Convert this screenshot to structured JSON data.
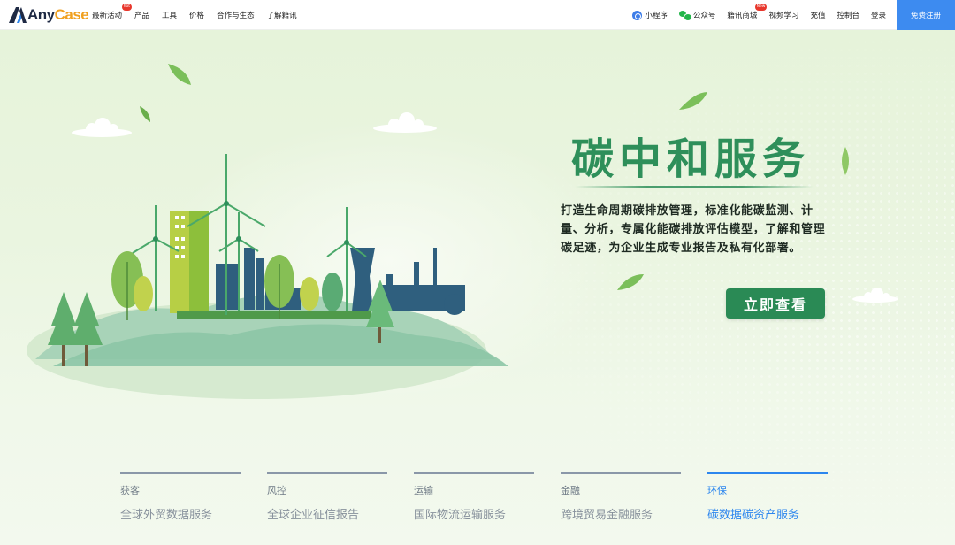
{
  "header": {
    "logo": {
      "part1": "Any",
      "part2": "Case"
    },
    "nav_left": [
      {
        "label": "最新活动",
        "badge": "hot"
      },
      {
        "label": "产品",
        "badge": ""
      },
      {
        "label": "工具",
        "badge": ""
      },
      {
        "label": "价格",
        "badge": ""
      },
      {
        "label": "合作与生态",
        "badge": ""
      },
      {
        "label": "了解籍讯",
        "badge": ""
      }
    ],
    "nav_right": {
      "mini_program": "小程序",
      "official_account": "公众号",
      "mall": "籍讯商城",
      "mall_badge": "New",
      "video": "视频学习",
      "recharge": "充值",
      "console": "控制台",
      "login": "登录"
    },
    "register": "免费注册"
  },
  "banner": {
    "title": "碳中和服务",
    "description": "打造生命周期碳排放管理，标准化能碳监测、计量、分析，专属化能碳排放评估模型，了解和管理碳足迹，为企业生成专业报告及私有化部署。",
    "cta": "立即查看",
    "colors": {
      "title": "#2e8f5a",
      "cta_bg": "#2a8a55",
      "active": "#2c86ee"
    }
  },
  "cards": [
    {
      "category": "获客",
      "title": "全球外贸数据服务",
      "active": false
    },
    {
      "category": "风控",
      "title": "全球企业征信报告",
      "active": false
    },
    {
      "category": "运输",
      "title": "国际物流运输服务",
      "active": false
    },
    {
      "category": "金融",
      "title": "跨境贸易金融服务",
      "active": false
    },
    {
      "category": "环保",
      "title": "碳数据碳资产服务",
      "active": true
    }
  ]
}
